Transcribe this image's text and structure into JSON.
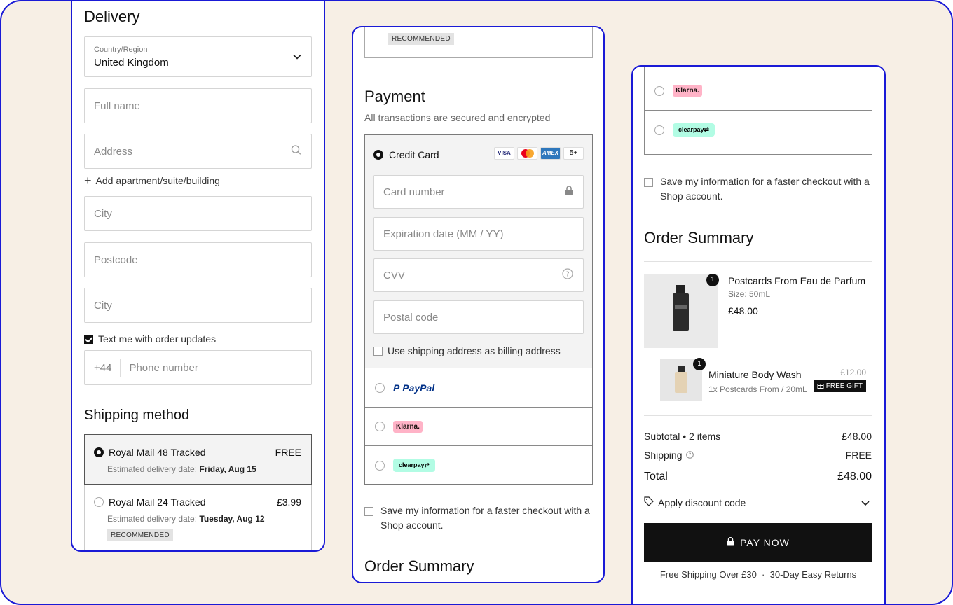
{
  "delivery": {
    "title": "Delivery",
    "country_label": "Country/Region",
    "country_value": "United Kingdom",
    "full_name_placeholder": "Full name",
    "address_placeholder": "Address",
    "add_apartment": "Add apartment/suite/building",
    "city_placeholder": "City",
    "postcode_placeholder": "Postcode",
    "city2_placeholder": "City",
    "text_updates": "Text me with order updates",
    "phone_prefix": "+44",
    "phone_placeholder": "Phone number"
  },
  "shipping": {
    "title": "Shipping method",
    "est_label": "Estimated delivery date:",
    "options": [
      {
        "name": "Royal Mail 48 Tracked",
        "price": "FREE",
        "date": "Friday, Aug 15"
      },
      {
        "name": "Royal Mail 24 Tracked",
        "price": "£3.99",
        "date": "Tuesday, Aug 12",
        "badge": "RECOMMENDED"
      }
    ]
  },
  "payment": {
    "top_badge": "RECOMMENDED",
    "title": "Payment",
    "subtitle": "All transactions are secured and encrypted",
    "credit_card": "Credit Card",
    "card_logos": [
      "VISA",
      "",
      "AMEX",
      "5+"
    ],
    "card_number_placeholder": "Card number",
    "expiration_placeholder": "Expiration date (MM / YY)",
    "cvv_placeholder": "CVV",
    "postal_placeholder": "Postal code",
    "billing_same": "Use shipping address as billing address",
    "paypal": "PayPal",
    "klarna": "Klarna.",
    "clearpay": "clearpay",
    "save_info": "Save my information for a faster checkout with a Shop account.",
    "order_summary_title": "Order Summary"
  },
  "summary": {
    "klarna": "Klarna.",
    "clearpay": "clearpay",
    "save_info": "Save my information for a faster checkout with a Shop account.",
    "title": "Order Summary",
    "items": [
      {
        "qty": "1",
        "name": "Postcards From Eau de Parfum",
        "size": "Size: 50mL",
        "price": "£48.00"
      },
      {
        "qty": "1",
        "name": "Miniature Body Wash",
        "sub": "1x Postcards From / 20mL",
        "old_price": "£12.00",
        "gift": "FREE GIFT"
      }
    ],
    "subtotal_label": "Subtotal • 2 items",
    "subtotal_value": "£48.00",
    "shipping_label": "Shipping",
    "shipping_value": "FREE",
    "total_label": "Total",
    "total_value": "£48.00",
    "discount": "Apply discount code",
    "pay_now": "PAY NOW",
    "footer": "Free Shipping Over £30  ·  30-Day Easy Returns"
  },
  "colors": {
    "accent_border": "#1a1ad6",
    "background": "#f7efe5",
    "button": "#111111"
  }
}
